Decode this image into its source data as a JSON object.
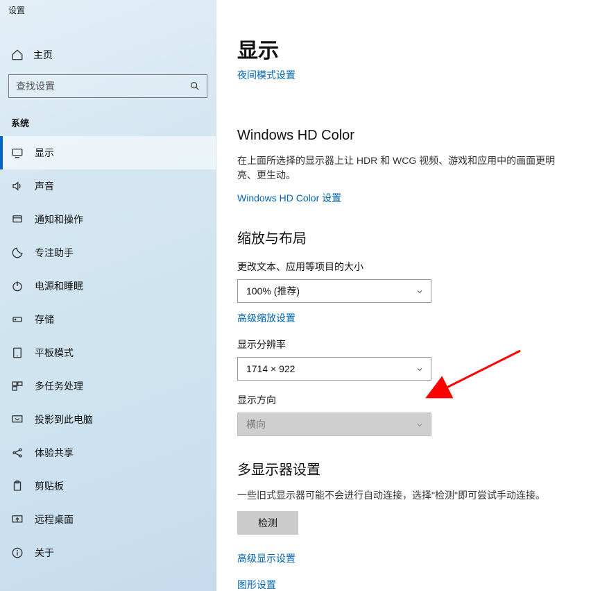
{
  "window_title": "设置",
  "home_label": "主页",
  "search_placeholder": "查找设置",
  "group_label": "系统",
  "nav": [
    {
      "id": "display",
      "label": "显示",
      "selected": true
    },
    {
      "id": "sound",
      "label": "声音",
      "selected": false
    },
    {
      "id": "notify",
      "label": "通知和操作",
      "selected": false
    },
    {
      "id": "focus",
      "label": "专注助手",
      "selected": false
    },
    {
      "id": "power",
      "label": "电源和睡眠",
      "selected": false
    },
    {
      "id": "storage",
      "label": "存储",
      "selected": false
    },
    {
      "id": "tablet",
      "label": "平板模式",
      "selected": false
    },
    {
      "id": "multitask",
      "label": "多任务处理",
      "selected": false
    },
    {
      "id": "project",
      "label": "投影到此电脑",
      "selected": false
    },
    {
      "id": "shared",
      "label": "体验共享",
      "selected": false
    },
    {
      "id": "clipboard",
      "label": "剪贴板",
      "selected": false
    },
    {
      "id": "remote",
      "label": "远程桌面",
      "selected": false
    },
    {
      "id": "about",
      "label": "关于",
      "selected": false
    }
  ],
  "page": {
    "title": "显示",
    "nightmode_link": "夜间模式设置",
    "hd": {
      "title": "Windows HD Color",
      "desc": "在上面所选择的显示器上让 HDR 和 WCG 视频、游戏和应用中的画面更明亮、更生动。",
      "link": "Windows HD Color 设置"
    },
    "scale": {
      "title": "缩放与布局",
      "size_label": "更改文本、应用等项目的大小",
      "size_value": "100% (推荐)",
      "adv_link": "高级缩放设置",
      "res_label": "显示分辨率",
      "res_value": "1714 × 922",
      "orient_label": "显示方向",
      "orient_value": "横向"
    },
    "multi": {
      "title": "多显示器设置",
      "desc": "一些旧式显示器可能不会进行自动连接，选择\"检测\"即可尝试手动连接。",
      "detect_btn": "检测"
    },
    "links": {
      "adv_display": "高级显示设置",
      "graphics": "图形设置"
    }
  },
  "annotation": {
    "arrow_color": "#ff0000",
    "target": "orientation-dropdown"
  }
}
